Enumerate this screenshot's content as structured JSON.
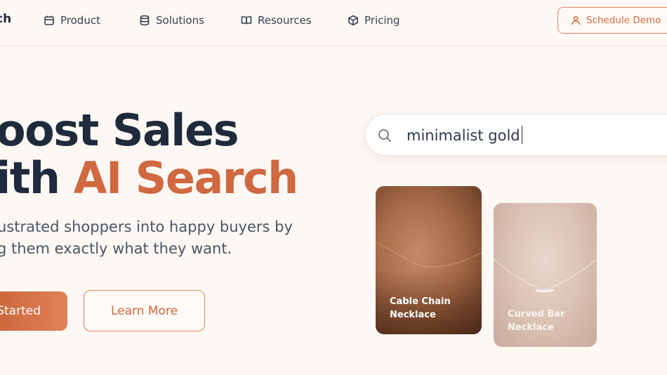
{
  "brand": {
    "logo_text": "ch"
  },
  "nav": {
    "items": [
      {
        "label": "Product",
        "icon": "calendar-icon"
      },
      {
        "label": "Solutions",
        "icon": "database-icon"
      },
      {
        "label": "Resources",
        "icon": "book-icon"
      },
      {
        "label": "Pricing",
        "icon": "cube-icon"
      }
    ],
    "cta_label": "Schedule Demo"
  },
  "hero": {
    "title_line1": "oost Sales",
    "title_line2_plain": "ith ",
    "title_line2_accent": "AI Search",
    "subtitle_line1": "ustrated shoppers into happy buyers by",
    "subtitle_line2": "g them exactly what they want.",
    "primary_button": "Started",
    "secondary_button": "Learn More"
  },
  "search": {
    "query": "minimalist gold"
  },
  "products": [
    {
      "name": "Cable Chain\nNecklace"
    },
    {
      "name": "Curved Bar\nNecklace"
    }
  ],
  "colors": {
    "accent": "#d06840",
    "dark_text": "#1f2a3c",
    "background": "#fdf8f4"
  }
}
